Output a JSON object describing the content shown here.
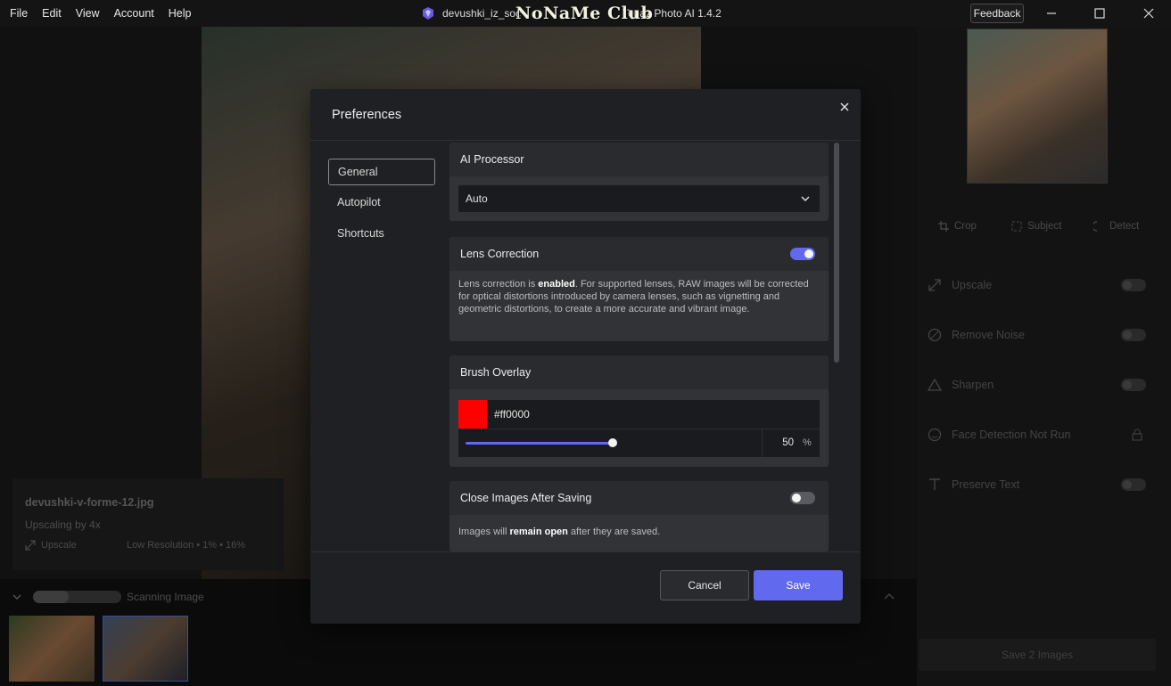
{
  "menu": [
    "File",
    "Edit",
    "View",
    "Account",
    "Help"
  ],
  "window": {
    "title_prefix": "devushki_iz_soc",
    "title_suffix": "Topaz Photo AI 1.4.2",
    "watermark": "NoNaMe Club",
    "feedback_label": "Feedback"
  },
  "image_info": {
    "filename": "devushki-v-forme-12.jpg",
    "upscaling": "Upscaling by 4x",
    "upscale_label": "Upscale",
    "resolution": "Low Resolution  •  1%  •  16%"
  },
  "filmstrip": {
    "status": "Scanning Image",
    "progress": 0.4
  },
  "right_panel": {
    "tools": [
      "Crop",
      "Subject",
      "Detect"
    ],
    "features": [
      "Upscale",
      "Remove Noise",
      "Sharpen",
      "Face Detection Not Run",
      "Preserve Text"
    ],
    "save_all_label": "Save 2 Images"
  },
  "dialog": {
    "title": "Preferences",
    "nav": [
      "General",
      "Autopilot",
      "Shortcuts"
    ],
    "ai_processor": {
      "title": "AI Processor",
      "value": "Auto"
    },
    "lens_correction": {
      "title": "Lens Correction",
      "enabled": true,
      "desc_pre": "Lens correction is ",
      "desc_bold": "enabled",
      "desc_post": ". For supported lenses, RAW images will be corrected for optical distortions introduced by camera lenses, such as vignetting and geometric distortions, to create a more accurate and vibrant image."
    },
    "brush_overlay": {
      "title": "Brush Overlay",
      "color": "#ff0000",
      "opacity": "50",
      "unit": "%"
    },
    "close_after_saving": {
      "title": "Close Images After Saving",
      "enabled": false,
      "desc_pre": "Images will ",
      "desc_bold": "remain open",
      "desc_post": " after they are saved."
    },
    "cancel_label": "Cancel",
    "save_label": "Save"
  },
  "colors": {
    "accent": "#6169ef",
    "dialog_bg": "#1f2023",
    "card_bg": "#2a2b2f"
  }
}
